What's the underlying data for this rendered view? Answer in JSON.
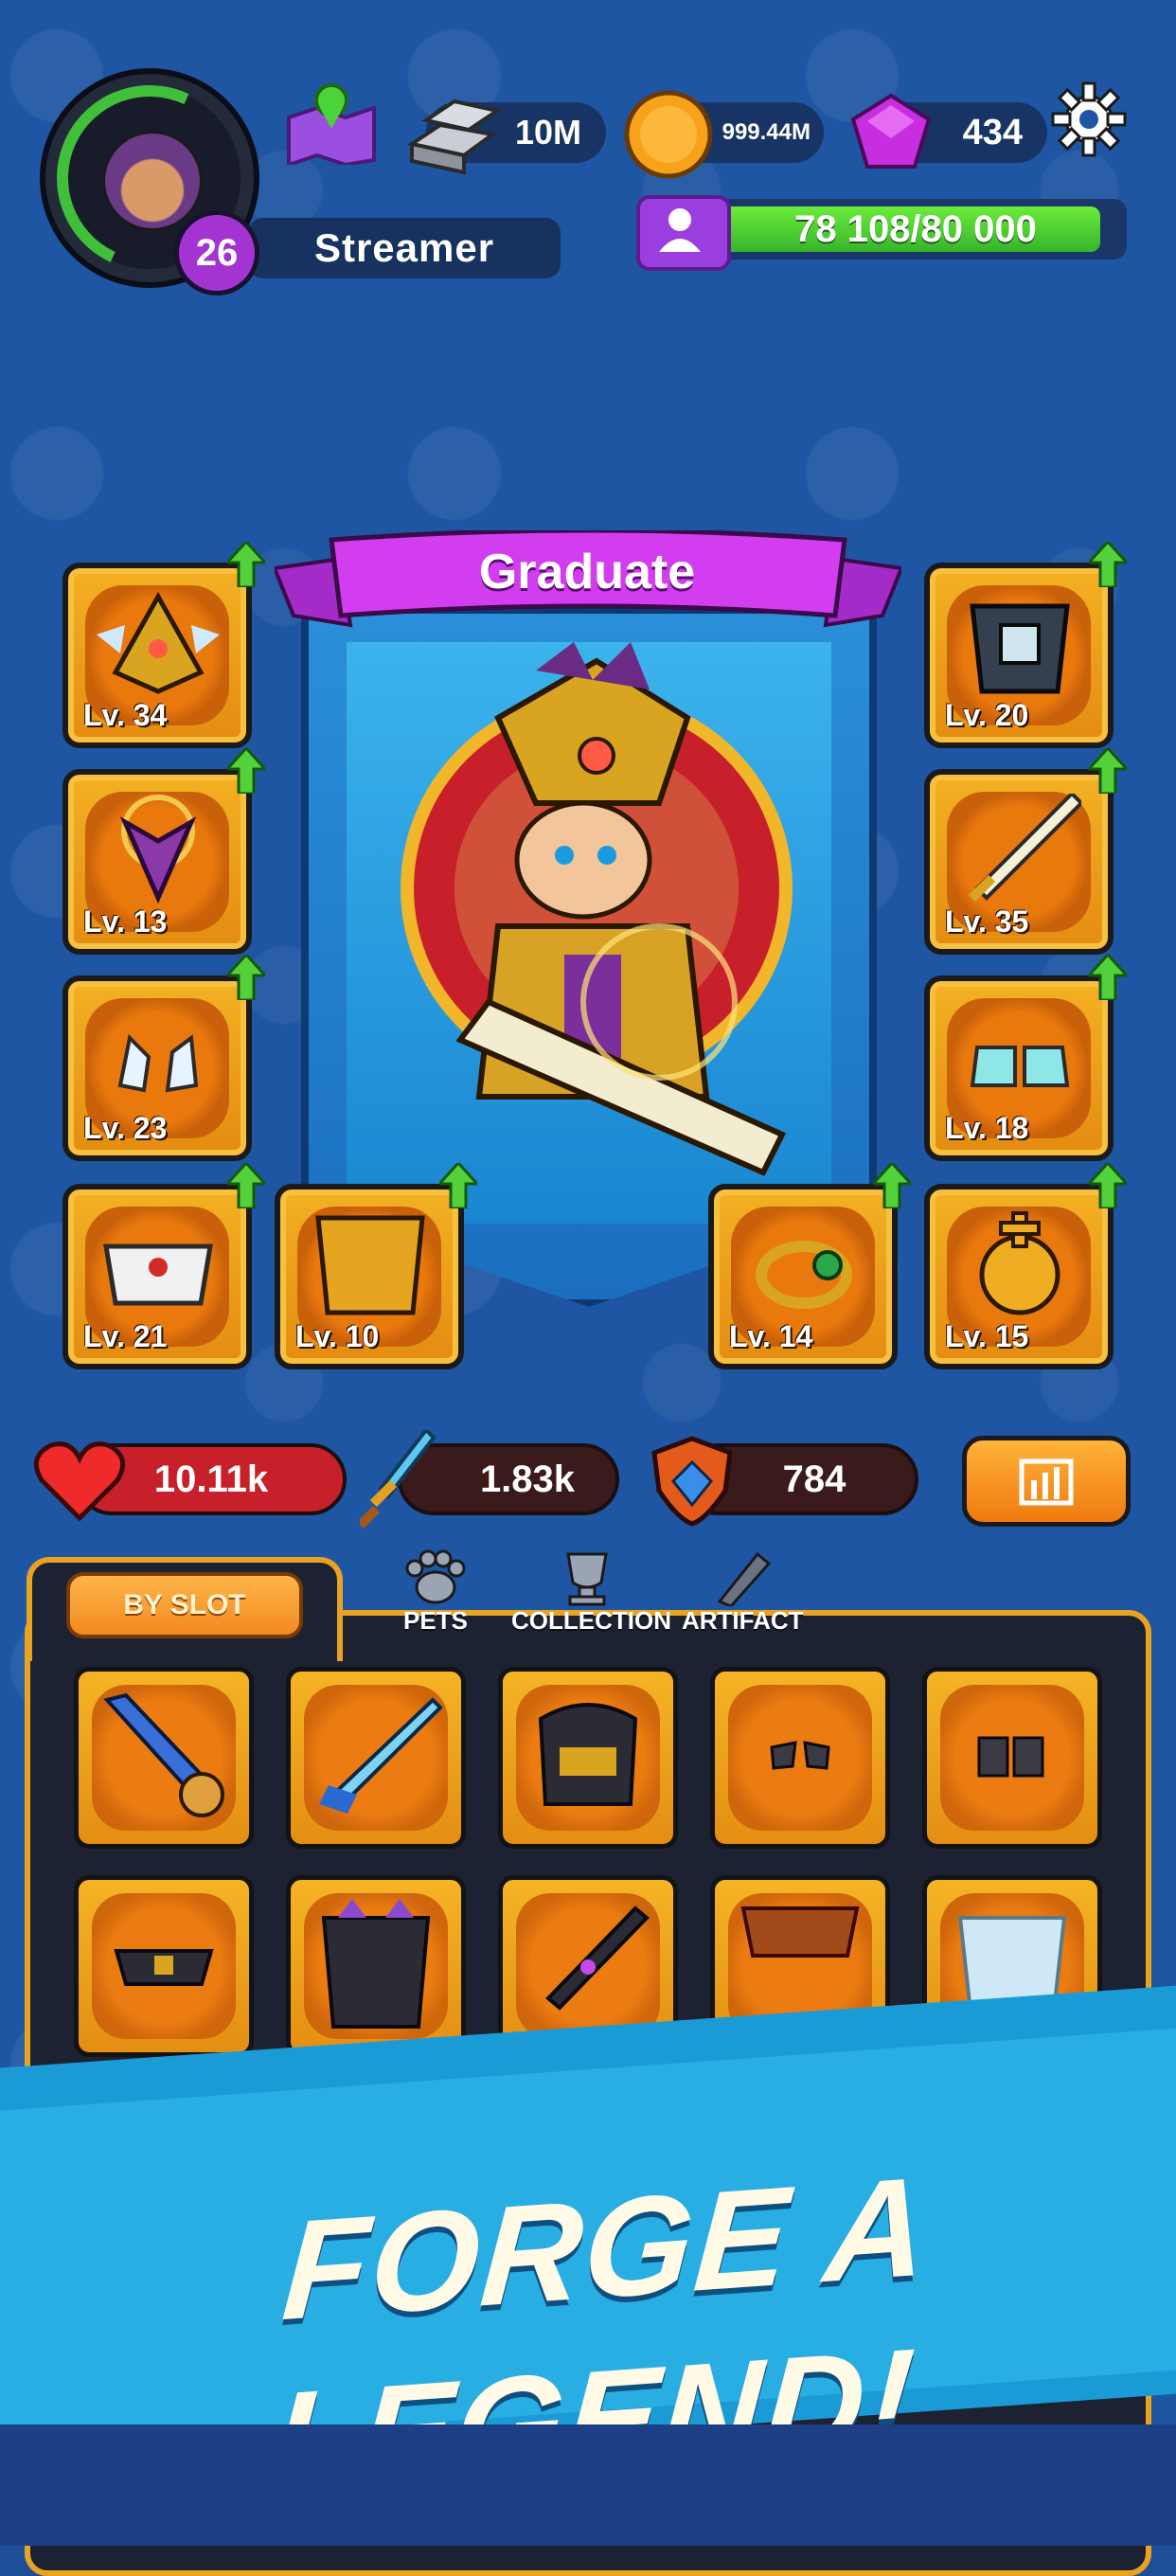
{
  "player": {
    "level": "26",
    "name": "Streamer"
  },
  "resources": {
    "silver": "10M",
    "gold": "999.44M",
    "gems": "434"
  },
  "xp": {
    "text": "78 108/80 000",
    "fraction": 0.976
  },
  "hero": {
    "title": "Graduate"
  },
  "left_slots": [
    {
      "level": "Lv. 34"
    },
    {
      "level": "Lv. 13"
    },
    {
      "level": "Lv. 23"
    },
    {
      "level": "Lv. 21"
    }
  ],
  "bottom_slots": [
    {
      "level": "Lv. 10"
    },
    {
      "level": "Lv. 14"
    }
  ],
  "right_slots": [
    {
      "level": "Lv. 20"
    },
    {
      "level": "Lv. 35"
    },
    {
      "level": "Lv. 18"
    },
    {
      "level": "Lv. 15"
    }
  ],
  "stats": {
    "health": "10.11k",
    "attack": "1.83k",
    "defense": "784"
  },
  "tabs": {
    "by_slot": "BY SLOT",
    "pets": "PETS",
    "collection": "COLLECTION",
    "artifact": "ARTIFACT"
  },
  "inventory": [
    {
      "item": "sword"
    },
    {
      "item": "ice-sword"
    },
    {
      "item": "helmet"
    },
    {
      "item": "gloves"
    },
    {
      "item": "boots"
    },
    {
      "item": "belt"
    },
    {
      "item": "armor"
    },
    {
      "item": "dark-sword"
    },
    {
      "item": "cape"
    },
    {
      "item": "cloak"
    }
  ],
  "banner": {
    "text": "FORGE A LEGEND!"
  },
  "colors": {
    "background": "#1f56a3",
    "slot_gold": "#f3b123",
    "xp_green": "#4fd233",
    "accent_purple": "#a434d1",
    "banner_blue": "#29aee4"
  }
}
